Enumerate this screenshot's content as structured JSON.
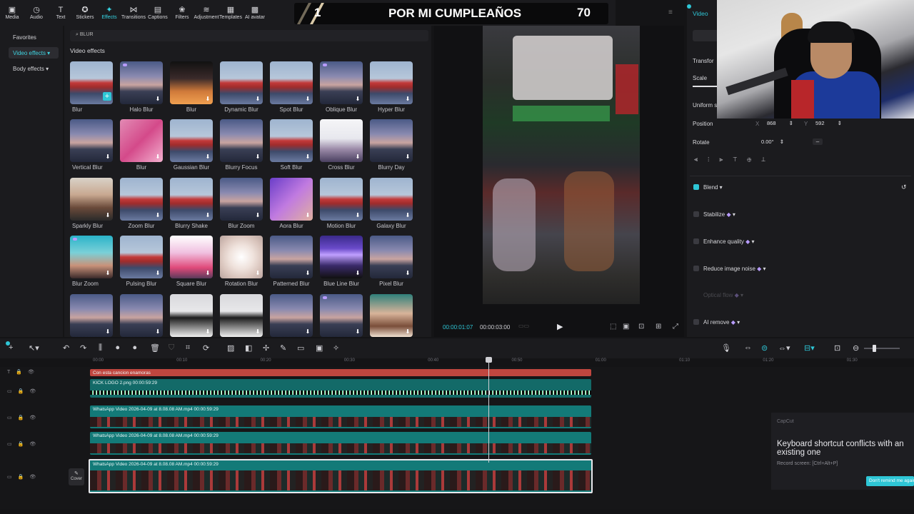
{
  "toolbar": {
    "tools": [
      {
        "label": "Media",
        "icon": "media-icon",
        "glyph": "▣"
      },
      {
        "label": "Audio",
        "icon": "audio-icon",
        "glyph": "◷"
      },
      {
        "label": "Text",
        "icon": "text-icon",
        "glyph": "T"
      },
      {
        "label": "Stickers",
        "icon": "stickers-icon",
        "glyph": "✪"
      },
      {
        "label": "Effects",
        "icon": "effects-icon",
        "glyph": "✦",
        "active": true
      },
      {
        "label": "Transitions",
        "icon": "transitions-icon",
        "glyph": "⋈"
      },
      {
        "label": "Captions",
        "icon": "captions-icon",
        "glyph": "▤"
      },
      {
        "label": "Filters",
        "icon": "filters-icon",
        "glyph": "❀"
      },
      {
        "label": "Adjustment",
        "icon": "adjustment-icon",
        "glyph": "≋"
      },
      {
        "label": "Templates",
        "icon": "templates-icon",
        "glyph": "▦"
      },
      {
        "label": "AI avatar",
        "icon": "ai-avatar-icon",
        "glyph": "▩"
      }
    ]
  },
  "overlay": {
    "number": "1",
    "title": "POR MI CUMPLEAÑOS",
    "count": "70"
  },
  "sidebar": {
    "items": [
      {
        "label": "Favorites"
      },
      {
        "label": "Video effects ▾",
        "selected": true
      },
      {
        "label": "Body effects ▾"
      }
    ]
  },
  "search": {
    "value": "BLUR"
  },
  "section": {
    "title": "Video effects"
  },
  "effects": [
    {
      "label": "Blur",
      "thumb": "t-man"
    },
    {
      "label": "Halo Blur",
      "thumb": "t-city",
      "premium": true
    },
    {
      "label": "Blur",
      "thumb": "t-orange"
    },
    {
      "label": "Dynamic Blur",
      "thumb": "t-man"
    },
    {
      "label": "Spot Blur",
      "thumb": "t-man"
    },
    {
      "label": "Oblique Blur",
      "thumb": "t-city",
      "premium": true
    },
    {
      "label": "Hyper Blur",
      "thumb": "t-man"
    },
    {
      "label": "Vertical Blur",
      "thumb": "t-city"
    },
    {
      "label": "Blur",
      "thumb": "t-pink"
    },
    {
      "label": "Gaussian Blur",
      "thumb": "t-man"
    },
    {
      "label": "Blurry Focus",
      "thumb": "t-city"
    },
    {
      "label": "Soft Blur",
      "thumb": "t-man"
    },
    {
      "label": "Cross Blur",
      "thumb": "t-white"
    },
    {
      "label": "Blurry Day",
      "thumb": "t-city"
    },
    {
      "label": "Sparkly Blur",
      "thumb": "t-face"
    },
    {
      "label": "Zoom Blur",
      "thumb": "t-man"
    },
    {
      "label": "Blurry Shake",
      "thumb": "t-man"
    },
    {
      "label": "Blur Zoom",
      "thumb": "t-city"
    },
    {
      "label": "Aora Blur",
      "thumb": "t-purple"
    },
    {
      "label": "Motion Blur",
      "thumb": "t-man"
    },
    {
      "label": "Galaxy Blur",
      "thumb": "t-man"
    },
    {
      "label": "Blur Zoom",
      "thumb": "t-teal",
      "premium": true
    },
    {
      "label": "Pulsing Blur",
      "thumb": "t-man"
    },
    {
      "label": "Square Blur",
      "thumb": "t-pinkbright"
    },
    {
      "label": "Rotation Blur",
      "thumb": "t-swirl"
    },
    {
      "label": "Patterned Blur",
      "thumb": "t-city"
    },
    {
      "label": "Blue Line Blur",
      "thumb": "t-concert"
    },
    {
      "label": "Pixel Blur",
      "thumb": "t-city"
    },
    {
      "label": "",
      "thumb": "t-city"
    },
    {
      "label": "",
      "thumb": "t-city"
    },
    {
      "label": "",
      "thumb": "t-dark"
    },
    {
      "label": "",
      "thumb": "t-dark"
    },
    {
      "label": "",
      "thumb": "t-city"
    },
    {
      "label": "",
      "thumb": "t-city",
      "premium": true
    },
    {
      "label": "",
      "thumb": "t-face2"
    }
  ],
  "player": {
    "current": "00:00:01:07",
    "total": "00:00:03:00"
  },
  "inspector": {
    "tab": "Video",
    "transform": "Transfor",
    "scale": "Scale",
    "uniform": "Uniform s",
    "position": {
      "label": "Position",
      "x_label": "X",
      "x": "868",
      "y_label": "Y",
      "y": "592"
    },
    "rotate": {
      "label": "Rotate",
      "value": "0.00°"
    },
    "options": [
      {
        "label": "Blend ▾",
        "checked": true
      },
      {
        "label": "Stabilize",
        "premium": true
      },
      {
        "label": "Enhance quality",
        "premium": true
      },
      {
        "label": "Reduce image noise",
        "premium": true
      },
      {
        "label": "Optical flow",
        "premium": true,
        "disabled": true
      },
      {
        "label": "AI remove",
        "premium": true
      }
    ]
  },
  "ruler": [
    "00:00",
    "00:10",
    "00:20",
    "00:30",
    "00:40",
    "00:50",
    "01:00",
    "01:10",
    "01:20",
    "01:30"
  ],
  "tracks": [
    {
      "label": "Con esta cancion enamoras",
      "kind": "text"
    },
    {
      "label": "KICK LOGO 2.png  00:00:59:29",
      "kind": "image"
    },
    {
      "label": "WhatsApp Video 2026-04-09 at 8.08.08 AM.mp4  00:00:59:29",
      "kind": "video"
    },
    {
      "label": "WhatsApp Video 2026-04-09 at 8.08.08 AM.mp4  00:00:59:29",
      "kind": "video"
    },
    {
      "label": "WhatsApp Video 2026-04-09 at 8.08.08 AM.mp4  00:00:59:29",
      "kind": "main"
    }
  ],
  "cover": {
    "label": "Cover"
  },
  "notification": {
    "app": "CapCut",
    "title": "Keyboard shortcut conflicts with an existing one",
    "subtitle": "Record screen: [Ctrl+Alt+P]",
    "button": "Don't remind me again"
  }
}
